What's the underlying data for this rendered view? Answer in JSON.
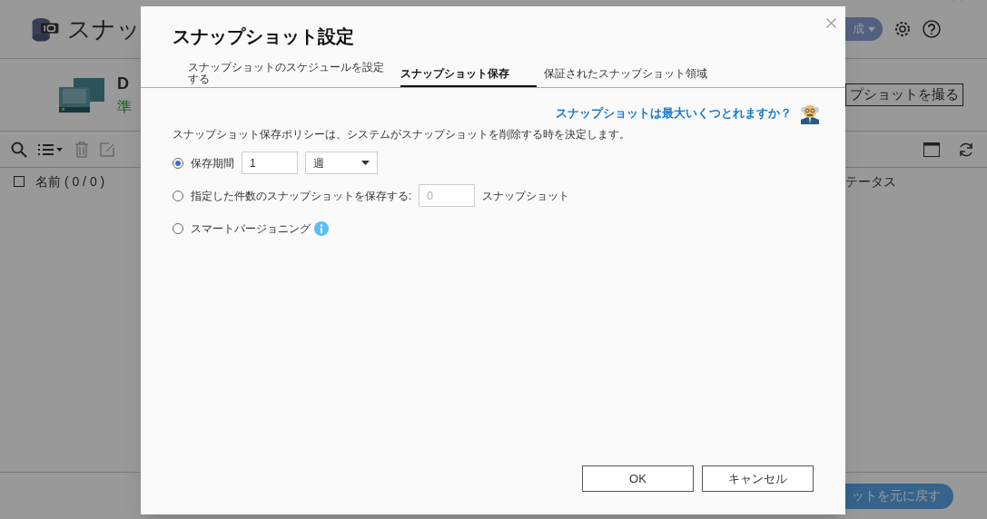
{
  "app": {
    "title": "スナッ",
    "header_button": "成",
    "volume_name": "D",
    "volume_status": "準",
    "take_snapshot_button": "プショットを撮る",
    "table": {
      "select_all_checked": false,
      "columns": [
        {
          "label": "名前 ( 0 / 0 )"
        },
        {
          "label": "テータス"
        }
      ]
    },
    "restore_button": "ットを元に戻す"
  },
  "dialog": {
    "title": "スナップショット設定",
    "tabs": [
      {
        "label": "スナップショットのスケジュールを設定する",
        "selected": false
      },
      {
        "label": "スナップショット保存",
        "selected": true
      },
      {
        "label": "保証されたスナップショット領域",
        "selected": false
      }
    ],
    "help_link": "スナップショットは最大いくつとれますか？",
    "description": "スナップショット保存ポリシーは、システムがスナップショットを削除する時を決定します。",
    "options": [
      {
        "kind": "period",
        "label": "保存期間",
        "selected": true,
        "value": "1",
        "unit": "週"
      },
      {
        "kind": "count",
        "label": "指定した件数のスナップショットを保存する:",
        "selected": false,
        "placeholder": "0",
        "suffix": "スナップショット"
      },
      {
        "kind": "smart",
        "label": "スマートバージョニング",
        "selected": false
      }
    ],
    "buttons": [
      "OK",
      "キャンセル"
    ]
  }
}
